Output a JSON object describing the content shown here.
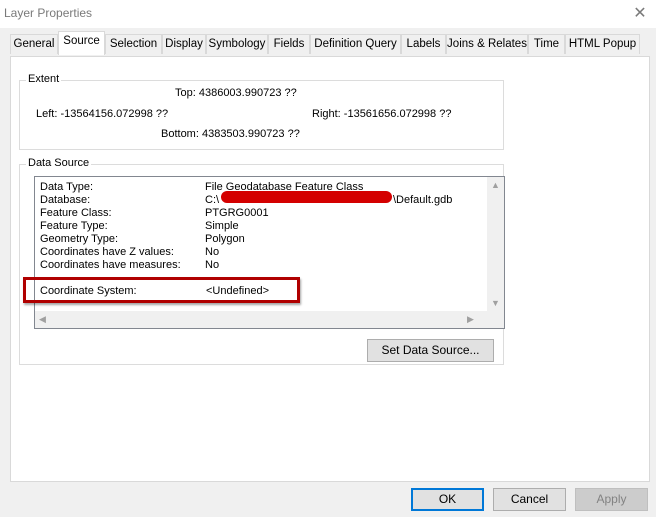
{
  "window": {
    "title": "Layer Properties",
    "close_glyph": "✕"
  },
  "tabs": [
    {
      "label": "General"
    },
    {
      "label": "Source"
    },
    {
      "label": "Selection"
    },
    {
      "label": "Display"
    },
    {
      "label": "Symbology"
    },
    {
      "label": "Fields"
    },
    {
      "label": "Definition Query"
    },
    {
      "label": "Labels"
    },
    {
      "label": "Joins & Relates"
    },
    {
      "label": "Time"
    },
    {
      "label": "HTML Popup"
    }
  ],
  "active_tab": "Source",
  "extent": {
    "legend": "Extent",
    "top": "Top:   4386003.990723 ??",
    "left": "Left:  -13564156.072998 ??",
    "right": "Right:   -13561656.072998 ??",
    "bottom": "Bottom:   4383503.990723 ??"
  },
  "data_source": {
    "legend": "Data Source",
    "rows": [
      {
        "key": "Data Type:",
        "value": "File Geodatabase Feature Class"
      },
      {
        "key": "Database:",
        "value": "C:\\",
        "value_tail": "\\Default.gdb"
      },
      {
        "key": "Feature Class:",
        "value": "PTGRG0001"
      },
      {
        "key": "Feature Type:",
        "value": "Simple"
      },
      {
        "key": "Geometry Type:",
        "value": "Polygon"
      },
      {
        "key": "Coordinates have Z values:",
        "value": "No"
      },
      {
        "key": "Coordinates have measures:",
        "value": "No"
      },
      {
        "key": "Coordinate System:",
        "value": "<Undefined>"
      }
    ],
    "set_button": "Set Data Source..."
  },
  "footer": {
    "ok": "OK",
    "cancel": "Cancel",
    "apply": "Apply"
  },
  "colors": {
    "highlight_border": "#b00000",
    "redaction": "#d40000",
    "default_button_border": "#0078d7"
  }
}
